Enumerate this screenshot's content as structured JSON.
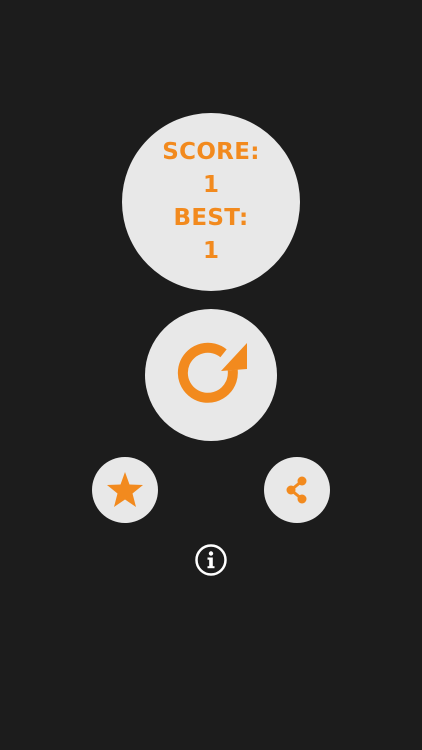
{
  "score_panel": {
    "score_label": "SCORE:",
    "score_value": "1",
    "best_label": "BEST:",
    "best_value": "1"
  },
  "buttons": {
    "restart_icon": "restart-icon",
    "rate_icon": "star-icon",
    "share_icon": "share-icon",
    "info_icon": "info-icon"
  },
  "colors": {
    "background": "#1c1c1c",
    "button_fill": "#e8e8e8",
    "accent": "#f28a1e",
    "info_icon": "#ffffff"
  }
}
